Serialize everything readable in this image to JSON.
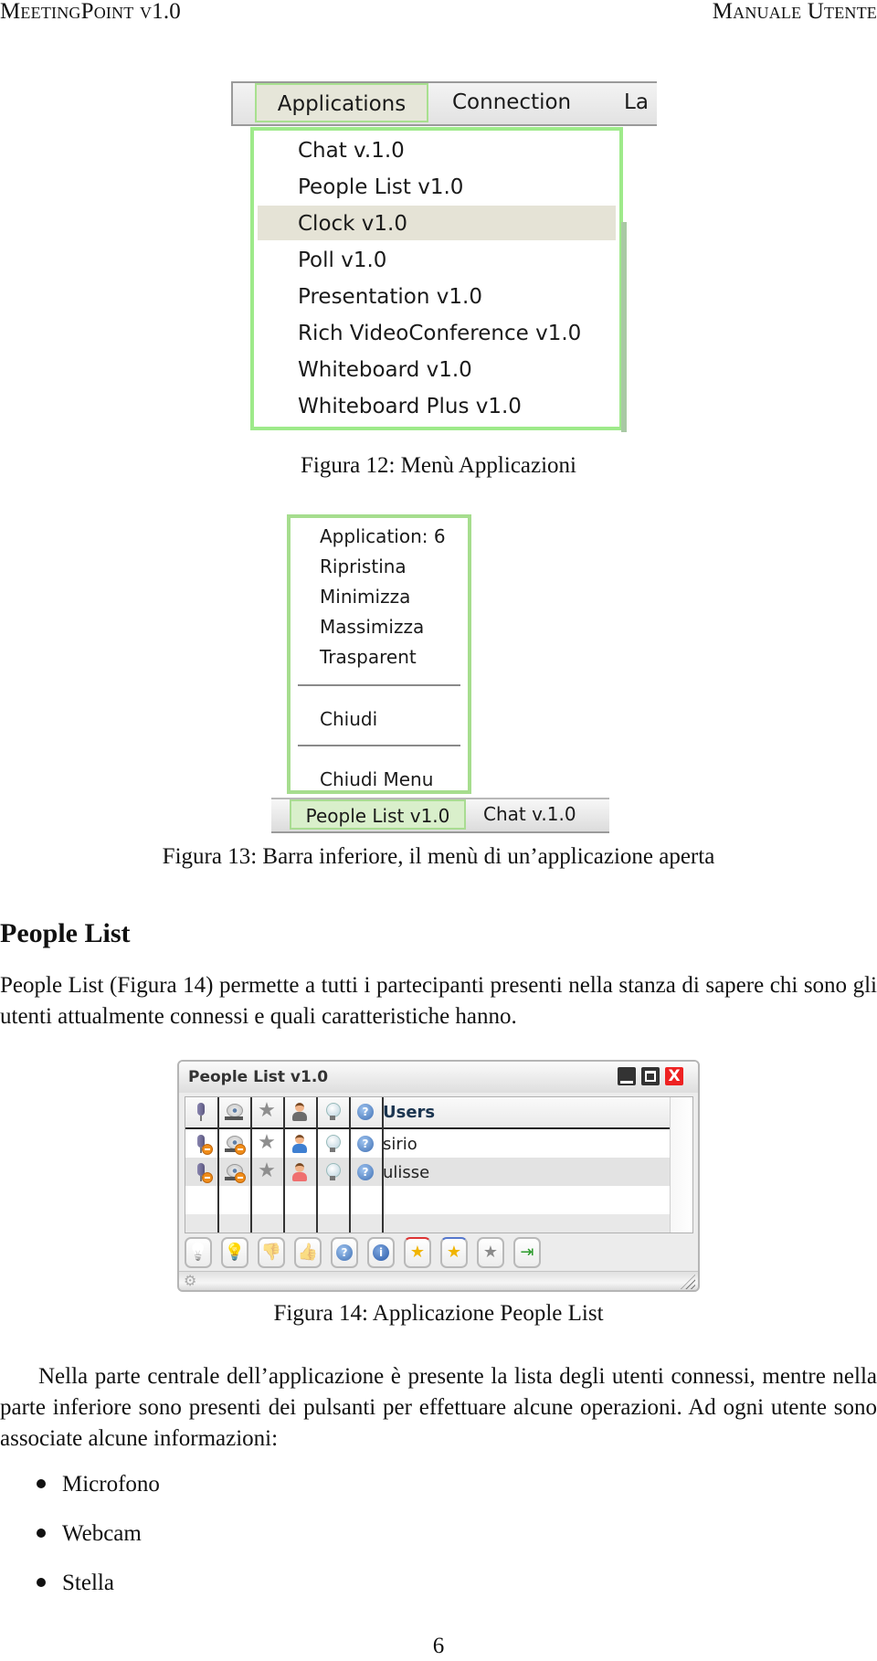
{
  "header": {
    "left": "MeetingPoint v1.0",
    "right": "Manuale Utente"
  },
  "figure12": {
    "menubar": [
      "Applications",
      "Connection",
      "La"
    ],
    "active_menu": "Applications",
    "dropdown_items": [
      "Chat v.1.0",
      "People List v1.0",
      "Clock v1.0",
      "Poll v1.0",
      "Presentation v1.0",
      "Rich VideoConference v1.0",
      "Whiteboard v1.0",
      "Whiteboard Plus v1.0"
    ],
    "highlighted_item": "Clock v1.0",
    "caption": "Figura 12: Menù Applicazioni",
    "accent_color": "#9eea8a",
    "highlight_color": "#e5e3d6"
  },
  "figure13": {
    "context_menu": {
      "title": "Application: 6",
      "items": [
        "Ripristina",
        "Minimizza",
        "Massimizza",
        "Trasparent"
      ],
      "close": "Chiudi",
      "close_menu": "Chiudi Menu"
    },
    "taskbar": [
      "People List v1.0",
      "Chat v.1.0"
    ],
    "active_task": "People List v1.0",
    "caption": "Figura 13: Barra inferiore, il menù di un’applicazione aperta"
  },
  "section": {
    "title": "People List",
    "intro": "People List (Figura 14) permette a tutti i partecipanti presenti nella stanza di sapere chi sono gli utenti attualmente connessi e quali caratteristiche hanno."
  },
  "figure14": {
    "window_title": "People List v1.0",
    "window_buttons": [
      "minimize",
      "maximize",
      "close"
    ],
    "close_glyph": "X",
    "columns": [
      "microphone-icon",
      "webcam-icon",
      "star-icon",
      "person-icon",
      "lightbulb-icon",
      "help-icon",
      "Users"
    ],
    "users_header": "Users",
    "users": [
      {
        "name": "sirio",
        "mic": "disabled",
        "webcam": "disabled",
        "star": "none",
        "gender": "male",
        "bulb": "off",
        "help": "info"
      },
      {
        "name": "ulisse",
        "mic": "disabled",
        "webcam": "disabled",
        "star": "none",
        "gender": "female",
        "bulb": "off",
        "help": "info",
        "selected": true
      }
    ],
    "toolbar_buttons": [
      {
        "name": "lightbulb-off",
        "glyph": "💡"
      },
      {
        "name": "lightbulb-on",
        "glyph": "💡"
      },
      {
        "name": "thumbs-down",
        "glyph": "👎"
      },
      {
        "name": "thumbs-up",
        "glyph": "👍"
      },
      {
        "name": "question",
        "glyph": "?"
      },
      {
        "name": "info",
        "glyph": "i"
      },
      {
        "name": "medal-red",
        "glyph": "★"
      },
      {
        "name": "medal-blue",
        "glyph": "★"
      },
      {
        "name": "star-grey",
        "glyph": "★"
      },
      {
        "name": "exit-door",
        "glyph": "⇥"
      }
    ],
    "status_icon": "⚙",
    "caption": "Figura 14: Applicazione People List"
  },
  "body": {
    "paragraph": "Nella parte centrale dell’applicazione è presente la lista degli utenti connessi, mentre nella parte inferiore sono presenti dei pulsanti per effettuare alcune operazioni. Ad ogni utente sono associate alcune informazioni:",
    "bullets": [
      "Microfono",
      "Webcam",
      "Stella"
    ]
  },
  "page_number": "6"
}
